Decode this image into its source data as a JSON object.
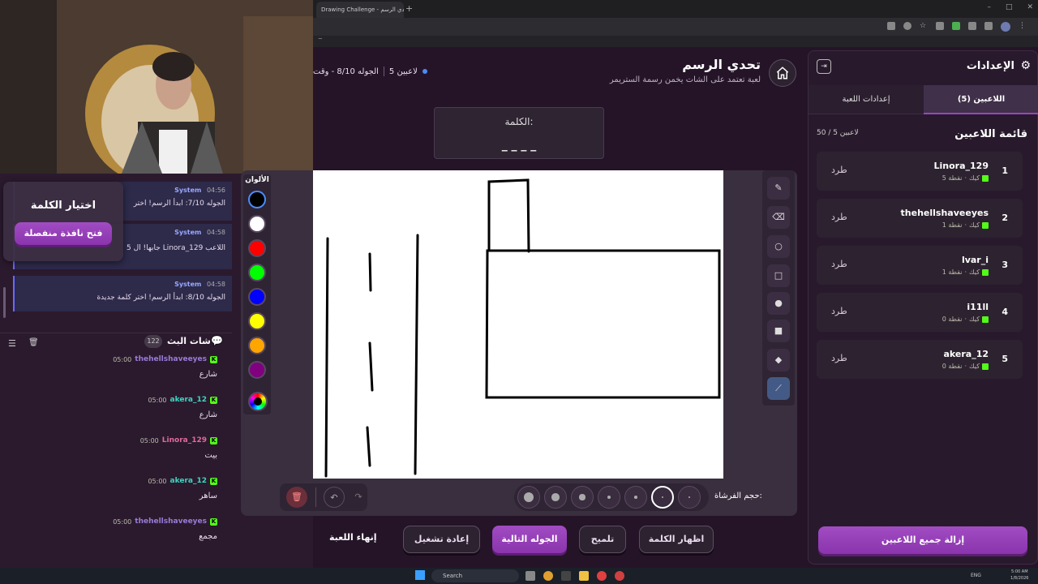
{
  "browser": {
    "tab_title": "Drawing Challenge - تحدي الرسم",
    "new_tab_glyph": "+",
    "window_controls": [
      "–",
      "□",
      "✕"
    ],
    "bookmarks_hint": "~"
  },
  "header": {
    "title": "تحدي الرسم",
    "subtitle": "لعبة تعتمد على الشات يخمن رسمة الستريمر",
    "players_count": "5 لاعبين",
    "round": "الجوله 8/10 - وقت"
  },
  "word_box": {
    "label": "الكلمة:",
    "hint": "_ _ _ _"
  },
  "colors": {
    "label": "الألوان",
    "swatches": [
      "#000000",
      "#ffffff",
      "#ff0000",
      "#00ff00",
      "#0000ff",
      "#ffff00",
      "#ffa500",
      "#800080"
    ]
  },
  "brush_bar": {
    "label": "حجم الفرشاة:",
    "sizes": [
      5,
      4,
      3,
      2,
      1.5,
      1,
      1
    ]
  },
  "controls": {
    "show_word": "اظهار الكلمة",
    "hint": "تلميح",
    "next_round": "الجوله التالية",
    "restart": "إعادة تشغيل",
    "end_game": "إنهاء اللعبة"
  },
  "word_picker": {
    "title": "اختيار الكلمة",
    "open_window": "فتح نافذة منفصلة"
  },
  "system_messages": [
    {
      "sender": "System",
      "time": "04:56",
      "text": "الجوله 7/10: ابدأ الرسم! اختر"
    },
    {
      "sender": "System",
      "time": "04:58",
      "text": "اللاعب Linora_129 جابها! ال 5"
    },
    {
      "sender": "System",
      "time": "04:58",
      "text": "الجوله 8/10: ابدأ الرسم! اختر كلمة جديدة"
    }
  ],
  "chat": {
    "title": "شات البث",
    "count": "122",
    "messages": [
      {
        "user": "thehellshaveeyes",
        "time": "05:00",
        "text": "شارع",
        "color": "#9a7bd8"
      },
      {
        "user": "akera_12",
        "time": "05:00",
        "text": "شارع",
        "color": "#3fd4c0"
      },
      {
        "user": "Linora_129",
        "time": "05:00",
        "text": "بيت",
        "color": "#e06a9a"
      },
      {
        "user": "akera_12",
        "time": "05:00",
        "text": "ساهر",
        "color": "#3fd4c0"
      },
      {
        "user": "thehellshaveeyes",
        "time": "05:00",
        "text": "مجمع",
        "color": "#9a7bd8"
      }
    ]
  },
  "settings": {
    "title": "الإعدادات",
    "tab_players": "اللاعبين (5)",
    "tab_game": "إعدادات اللعبة",
    "list_title": "قائمة اللاعبين",
    "capacity": "50 / 5 لاعبين",
    "kick_label": "طرد",
    "players": [
      {
        "rank": "1",
        "name": "Linora_129",
        "platform": "كيك",
        "points": "5 نقطة"
      },
      {
        "rank": "2",
        "name": "thehellshaveeyes",
        "platform": "كيك",
        "points": "1 نقطة"
      },
      {
        "rank": "3",
        "name": "lvar_i",
        "platform": "كيك",
        "points": "1 نقطة"
      },
      {
        "rank": "4",
        "name": "i11ll",
        "platform": "كيك",
        "points": "0 نقطة"
      },
      {
        "rank": "5",
        "name": "akera_12",
        "platform": "كيك",
        "points": "0 نقطة"
      }
    ],
    "remove_all": "إزالة جميع اللاعبين"
  },
  "taskbar": {
    "search": "Search",
    "lang": "ENG",
    "time": "5:00 AM",
    "date": "1/8/2026"
  },
  "accent_colors": {
    "primary": "#9b45bf",
    "kick_green": "#53fc18",
    "bg": "#251428"
  }
}
